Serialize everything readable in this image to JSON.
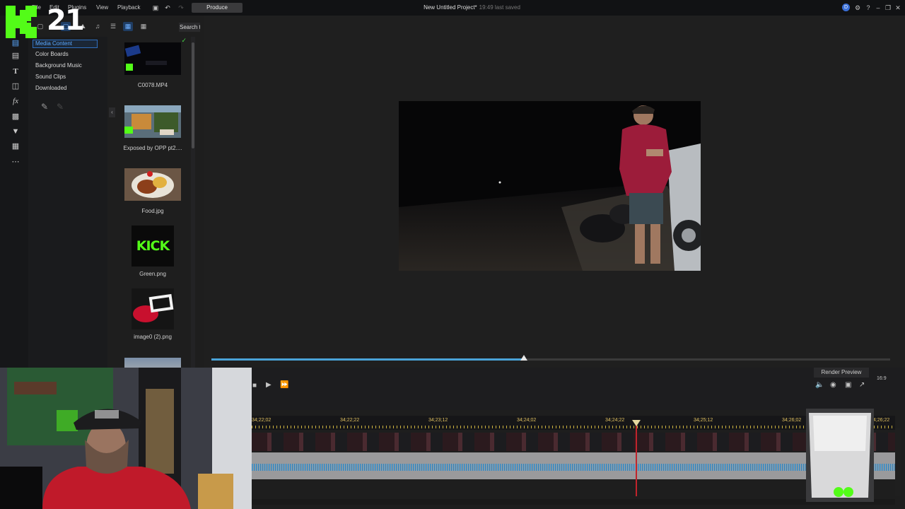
{
  "menu": {
    "file": "File",
    "edit": "Edit",
    "plugins": "Plugins",
    "view": "View",
    "playback": "Playback",
    "produce": "Produce"
  },
  "project": {
    "title": "New Untitled Project*",
    "saved": "19:49 last saved"
  },
  "user_badge": "D",
  "overlay": {
    "logo_letter": "K",
    "number": "21"
  },
  "library": {
    "search_label": "Search t",
    "tree": [
      {
        "label": "Media Content",
        "selected": true
      },
      {
        "label": "Color Boards"
      },
      {
        "label": "Background Music"
      },
      {
        "label": "Sound Clips"
      },
      {
        "label": "Downloaded"
      }
    ],
    "media": [
      {
        "name": "C0078.MP4"
      },
      {
        "name": "Exposed by OPP pt2...."
      },
      {
        "name": "Food.jpg"
      },
      {
        "name": "Green.png"
      },
      {
        "name": "image0 (2).png"
      }
    ],
    "kick_text": "KICK"
  },
  "preview": {
    "progress": 0.46
  },
  "timeline": {
    "render_preview": "Render Preview",
    "aspect": "16:9",
    "timecodes": [
      "34;22;02",
      "34;22;22",
      "34;23;12",
      "34;24;02",
      "34;24;22",
      "34;25;12",
      "34;26;02",
      "34;26;22"
    ]
  },
  "colors": {
    "accent": "#4aa3d8",
    "playhead": "#c0242c",
    "kick_green": "#53fc18",
    "selection": "#5aa8ff"
  }
}
